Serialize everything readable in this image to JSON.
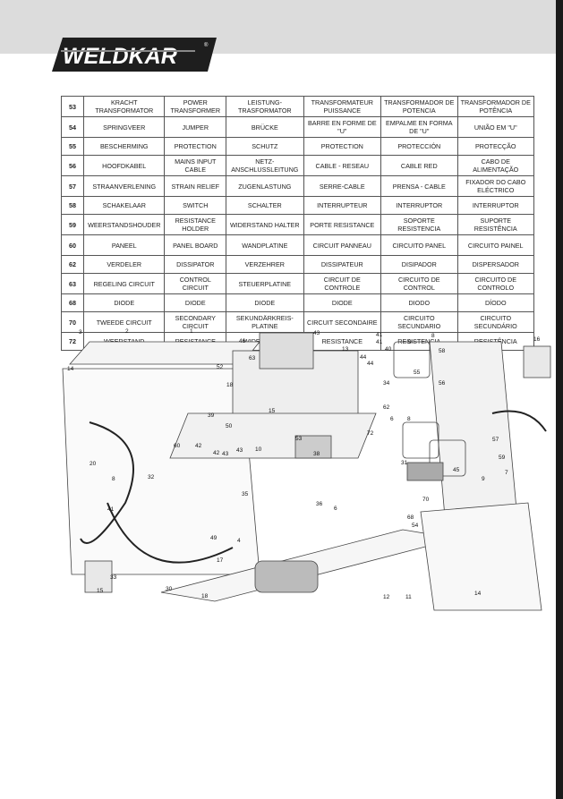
{
  "brand": {
    "logo_text": "WELDKAR",
    "registered": "®"
  },
  "parts_table": {
    "rows": [
      [
        "53",
        "KRACHT TRANSFORMATOR",
        "POWER TRANSFORMER",
        "LEISTUNG-TRASFORMATOR",
        "TRANSFORMATEUR PUISSANCE",
        "TRANSFORMADOR DE POTENCIA",
        "TRANSFORMADOR DE POTÊNCIA"
      ],
      [
        "54",
        "SPRINGVEER",
        "JUMPER",
        "BRÜCKE",
        "BARRE EN FORME DE \"U\"",
        "EMPALME EN FORMA DE \"U\"",
        "UNIÃO EM \"U\""
      ],
      [
        "55",
        "BESCHERMING",
        "PROTECTION",
        "SCHUTZ",
        "PROTECTION",
        "PROTECCIÓN",
        "PROTECÇÃO"
      ],
      [
        "56",
        "HOOFDKABEL",
        "MAINS INPUT CABLE",
        "NETZ-ANSCHLUSSLEITUNG",
        "CABLE - RESEAU",
        "CABLE RED",
        "CABO DE ALIMENTAÇÃO"
      ],
      [
        "57",
        "STRAANVERLENING",
        "STRAIN RELIEF",
        "ZUGENLASTUNG",
        "SERRE-CABLE",
        "PRENSA - CABLE",
        "FIXADOR DO CABO ELÉCTRICO"
      ],
      [
        "58",
        "SCHAKELAAR",
        "SWITCH",
        "SCHALTER",
        "INTERRUPTEUR",
        "INTERRUPTOR",
        "INTERRUPTOR"
      ],
      [
        "59",
        "WEERSTANDSHOUDER",
        "RESISTANCE HOLDER",
        "WIDERSTAND HALTER",
        "PORTE RESISTANCE",
        "SOPORTE RESISTENCIA",
        "SUPORTE RESISTÊNCIA"
      ],
      [
        "60",
        "PANEEL",
        "PANEL BOARD",
        "WANDPLATINE",
        "CIRCUIT PANNEAU",
        "CIRCUITO PANEL",
        "CIRCUITO PAINEL"
      ],
      [
        "62",
        "VERDELER",
        "DISSIPATOR",
        "VERZEHRER",
        "DISSIPATEUR",
        "DISIPADOR",
        "DISPERSADOR"
      ],
      [
        "63",
        "REGELING CIRCUIT",
        "CONTROL CIRCUIT",
        "STEUERPLATINE",
        "CIRCUIT DE CONTROLE",
        "CIRCUITO DE CONTROL",
        "CIRCUITO DE CONTROLO"
      ],
      [
        "68",
        "DIODE",
        "DIODE",
        "DIODE",
        "DIODE",
        "DIODO",
        "DÍODO"
      ],
      [
        "70",
        "TWEEDE CIRCUIT",
        "SECONDARY CIRCUIT",
        "SEKUNDÄRKREIS-PLATINE",
        "CIRCUIT SECONDAIRE",
        "CIRCUITO SECUNDARIO",
        "CIRCUITO SECUNDÁRIO"
      ],
      [
        "72",
        "WEERSTAND",
        "RESISTANCE",
        "WIDERSTAND",
        "RESISTANCE",
        "RESISTENCIA",
        "RESISTÊNCIA"
      ]
    ]
  },
  "diagram": {
    "part_labels": [
      "3",
      "2",
      "1",
      "14",
      "52",
      "46",
      "63",
      "43",
      "41",
      "41",
      "40",
      "13",
      "44",
      "44",
      "9",
      "8",
      "58",
      "16",
      "18",
      "15",
      "39",
      "50",
      "34",
      "55",
      "62",
      "6",
      "8",
      "72",
      "53",
      "38",
      "42",
      "42",
      "43",
      "43",
      "10",
      "60",
      "20",
      "31",
      "45",
      "9",
      "7",
      "57",
      "59",
      "56",
      "8",
      "32",
      "36",
      "70",
      "35",
      "41",
      "6",
      "68",
      "54",
      "49",
      "4",
      "17",
      "33",
      "30",
      "15",
      "18",
      "12",
      "11",
      "14"
    ]
  }
}
